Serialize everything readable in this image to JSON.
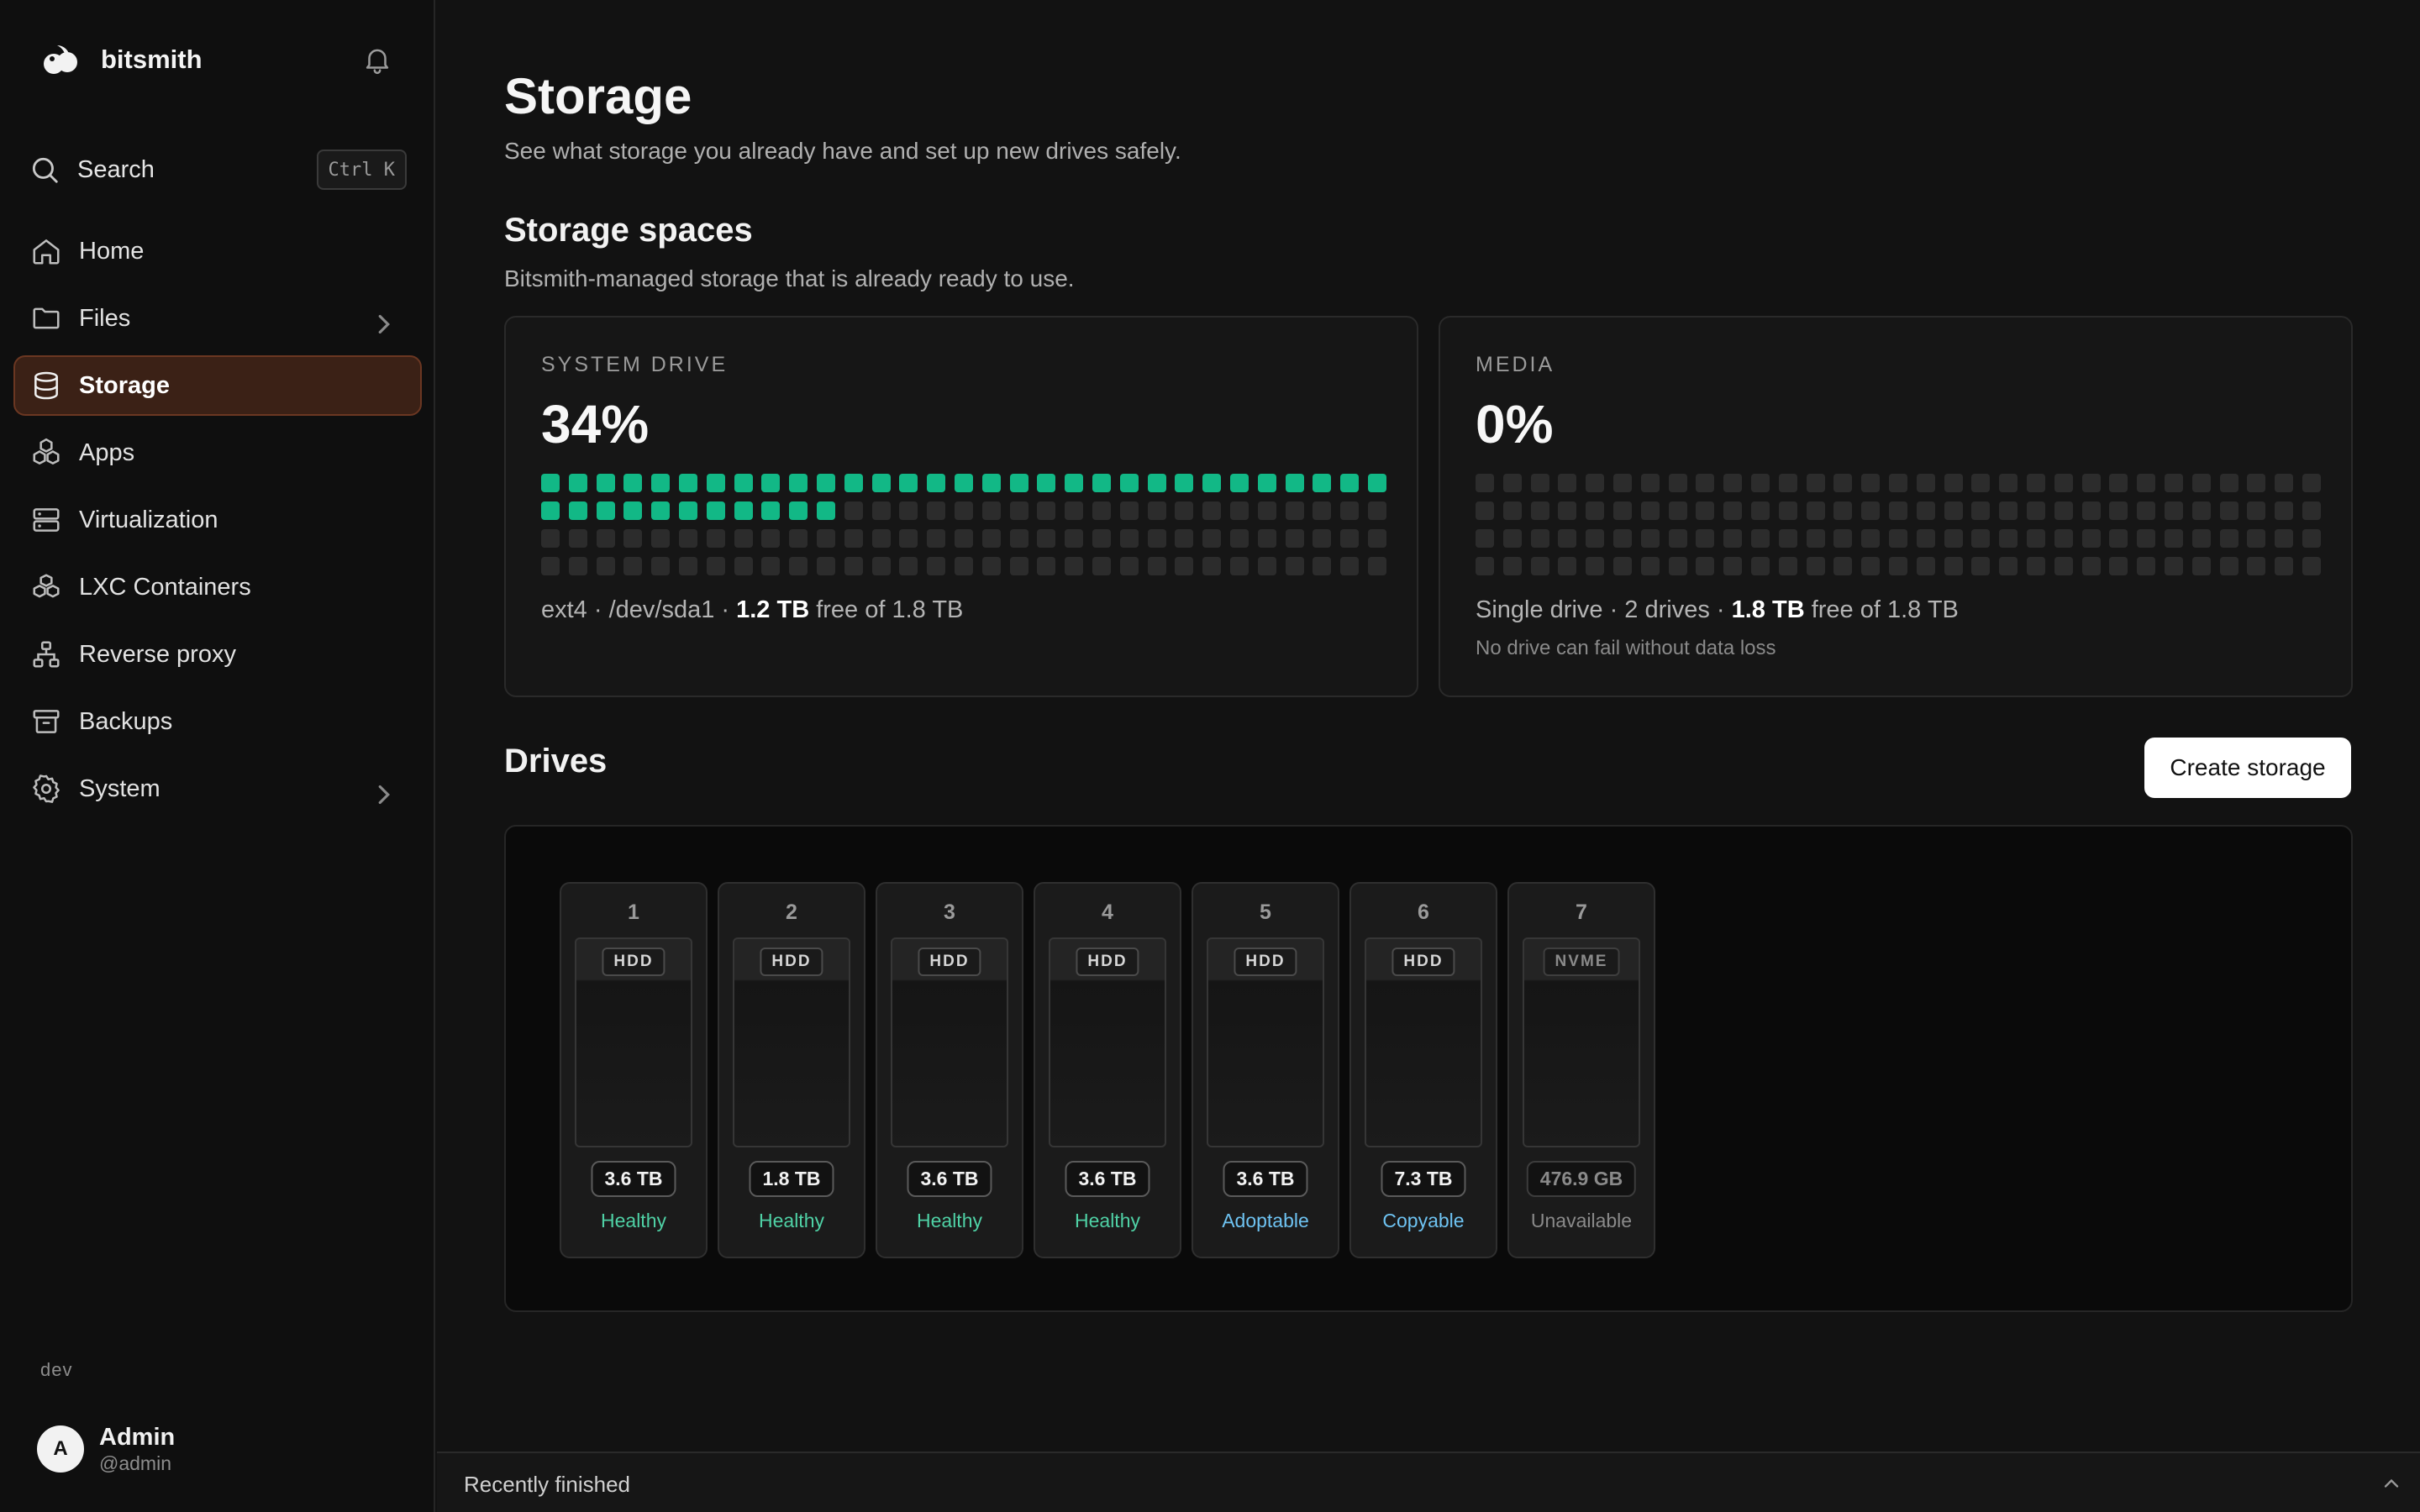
{
  "brand": {
    "name": "bitsmith"
  },
  "sidebar": {
    "search": {
      "label": "Search",
      "shortcut": "Ctrl K"
    },
    "items": [
      {
        "id": "home",
        "label": "Home",
        "icon": "home-icon",
        "active": false,
        "has_children": false
      },
      {
        "id": "files",
        "label": "Files",
        "icon": "folder-icon",
        "active": false,
        "has_children": true
      },
      {
        "id": "storage",
        "label": "Storage",
        "icon": "database-icon",
        "active": true,
        "has_children": false
      },
      {
        "id": "apps",
        "label": "Apps",
        "icon": "apps-icon",
        "active": false,
        "has_children": false
      },
      {
        "id": "virtualization",
        "label": "Virtualization",
        "icon": "server-icon",
        "active": false,
        "has_children": false
      },
      {
        "id": "lxc-containers",
        "label": "LXC Containers",
        "icon": "boxes-icon",
        "active": false,
        "has_children": false
      },
      {
        "id": "reverse-proxy",
        "label": "Reverse proxy",
        "icon": "network-icon",
        "active": false,
        "has_children": false
      },
      {
        "id": "backups",
        "label": "Backups",
        "icon": "archive-icon",
        "active": false,
        "has_children": false
      },
      {
        "id": "system",
        "label": "System",
        "icon": "gear-icon",
        "active": false,
        "has_children": true
      }
    ],
    "env_label": "dev",
    "user": {
      "avatar_letter": "A",
      "name": "Admin",
      "handle": "@admin"
    }
  },
  "page": {
    "title": "Storage",
    "subtitle": "See what storage you already have and set up new drives safely."
  },
  "storage_spaces": {
    "title": "Storage spaces",
    "subtitle": "Bitsmith-managed storage that is already ready to use.",
    "cards": [
      {
        "eyebrow": "SYSTEM DRIVE",
        "percent_label": "34%",
        "used_fraction": 0.34,
        "info_prefix": "ext4 · /dev/sda1 · ",
        "free_value": "1.2 TB",
        "info_suffix": " free of 1.8 TB",
        "note": ""
      },
      {
        "eyebrow": "MEDIA",
        "percent_label": "0%",
        "used_fraction": 0,
        "info_prefix": "Single drive · 2 drives · ",
        "free_value": "1.8 TB",
        "info_suffix": " free of 1.8 TB",
        "note": "No drive can fail without data loss"
      }
    ]
  },
  "drives": {
    "title": "Drives",
    "create_button": "Create storage",
    "bays": [
      {
        "number": "1",
        "type": "HDD",
        "size": "3.6 TB",
        "status": "Healthy",
        "status_color": "#4fd1a5"
      },
      {
        "number": "2",
        "type": "HDD",
        "size": "1.8 TB",
        "status": "Healthy",
        "status_color": "#4fd1a5"
      },
      {
        "number": "3",
        "type": "HDD",
        "size": "3.6 TB",
        "status": "Healthy",
        "status_color": "#4fd1a5"
      },
      {
        "number": "4",
        "type": "HDD",
        "size": "3.6 TB",
        "status": "Healthy",
        "status_color": "#4fd1a5"
      },
      {
        "number": "5",
        "type": "HDD",
        "size": "3.6 TB",
        "status": "Adoptable",
        "status_color": "#6ec3f2"
      },
      {
        "number": "6",
        "type": "HDD",
        "size": "7.3 TB",
        "status": "Copyable",
        "status_color": "#6ec3f2"
      },
      {
        "number": "7",
        "type": "NVME",
        "size": "476.9 GB",
        "status": "Unavailable",
        "status_color": "#8a8a8a"
      }
    ]
  },
  "bottom_bar": {
    "label": "Recently finished"
  },
  "colors": {
    "accent_active_bg": "#3b2116",
    "used_cell": "#12b886",
    "empty_cell": "#2c2c2c"
  }
}
